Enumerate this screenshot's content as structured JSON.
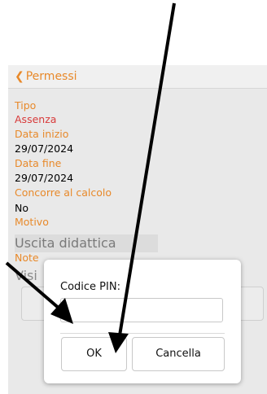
{
  "navbar": {
    "back_label": "Permessi"
  },
  "fields": {
    "tipo_label": "Tipo",
    "tipo_value": "Assenza",
    "data_inizio_label": "Data inizio",
    "data_inizio_value": "29/07/2024",
    "data_fine_label": "Data fine",
    "data_fine_value": "29/07/2024",
    "concorre_label": "Concorre al calcolo",
    "concorre_value": "No",
    "motivo_label": "Motivo",
    "motivo_value": "Uscita didattica",
    "note_label": "Note",
    "note_value": "Visi"
  },
  "dialog": {
    "pin_label": "Codice PIN:",
    "pin_value": "",
    "ok_label": "OK",
    "cancel_label": "Cancella"
  },
  "colors": {
    "accent": "#e8892a",
    "value_red": "#d83a3a",
    "arrow": "#000000"
  }
}
